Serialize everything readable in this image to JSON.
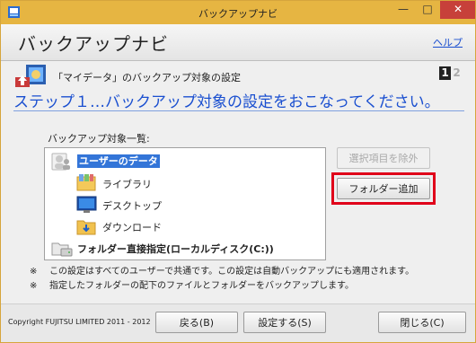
{
  "window": {
    "title": "バックアップナビ",
    "controls": {
      "minimize": "—",
      "maximize": "□",
      "close": "✕"
    }
  },
  "header": {
    "title": "バックアップナビ",
    "help_label": "ヘルプ"
  },
  "step": {
    "breadcrumb": "「マイデータ」のバックアップ対象の設定",
    "current": "1",
    "next": "2",
    "title": "ステップ１…バックアップ対象の設定をおこなってください。"
  },
  "list": {
    "label": "バックアップ対象一覧:",
    "items": [
      {
        "label": "ユーザーのデータ",
        "icon": "users-icon"
      },
      {
        "label": "ライブラリ",
        "icon": "library-icon"
      },
      {
        "label": "デスクトップ",
        "icon": "desktop-icon"
      },
      {
        "label": "ダウンロード",
        "icon": "download-folder-icon"
      },
      {
        "label": "フォルダー直接指定(ローカルディスク(C:))",
        "icon": "folder-drive-icon"
      }
    ]
  },
  "buttons": {
    "remove_label": "選択項目を除外",
    "add_folder_label": "フォルダー追加",
    "back_label": "戻る(B)",
    "settings_label": "設定する(S)",
    "close_label": "閉じる(C)"
  },
  "notes": [
    {
      "mark": "※",
      "text": "この設定はすべてのユーザーで共通です。この設定は自動バックアップにも適用されます。"
    },
    {
      "mark": "※",
      "text": "指定したフォルダーの配下のファイルとフォルダーをバックアップします。"
    }
  ],
  "footer": {
    "copyright": "Copyright FUJITSU LIMITED 2011 - 2012"
  },
  "colors": {
    "titlebar": "#e6b542",
    "accent_blue": "#1a4fd0",
    "selection": "#3375d8",
    "highlight_frame": "#e0001a"
  }
}
